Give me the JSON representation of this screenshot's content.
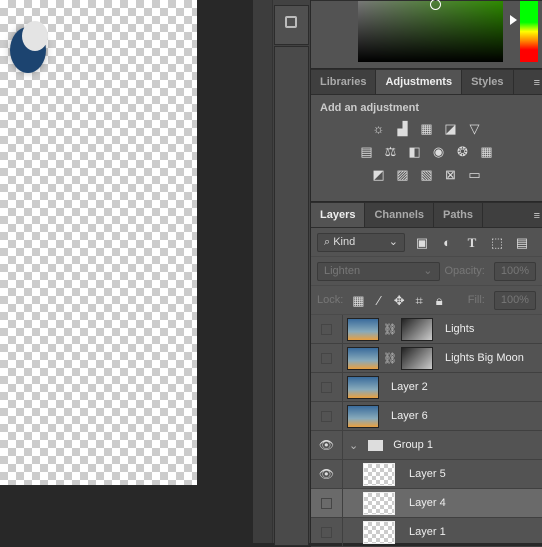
{
  "adjustments": {
    "tabs": [
      "Libraries",
      "Adjustments",
      "Styles"
    ],
    "active": "Adjustments",
    "heading": "Add an adjustment",
    "rows": [
      [
        "brightness-contrast",
        "levels",
        "curves",
        "exposure",
        "vibrance"
      ],
      [
        "hue-saturation",
        "color-balance",
        "black-white",
        "photo-filter",
        "channel-mixer",
        "color-lookup"
      ],
      [
        "invert",
        "posterize",
        "threshold",
        "gradient-map",
        "selective-color"
      ]
    ]
  },
  "layers": {
    "tabs": [
      "Layers",
      "Channels",
      "Paths"
    ],
    "active": "Layers",
    "filter": "Kind",
    "blend_mode": "Lighten",
    "opacity_label": "Opacity:",
    "opacity": "100%",
    "lock_label": "Lock:",
    "fill_label": "Fill:",
    "fill": "100%",
    "items": [
      {
        "name": "Lights",
        "visible": false,
        "type": "mask"
      },
      {
        "name": "Lights Big Moon",
        "visible": false,
        "type": "mask"
      },
      {
        "name": "Layer 2",
        "visible": false,
        "type": "image"
      },
      {
        "name": "Layer 6",
        "visible": false,
        "type": "image"
      },
      {
        "name": "Group 1",
        "visible": true,
        "type": "group"
      },
      {
        "name": "Layer 5",
        "visible": true,
        "type": "transparent"
      },
      {
        "name": "Layer 4",
        "visible": false,
        "type": "transparent",
        "selected": true
      },
      {
        "name": "Layer 1",
        "visible": false,
        "type": "transparent"
      }
    ]
  },
  "colors": {
    "panel": "#535353",
    "selected_layer": "#6a6a6a",
    "moon": "#1c4470"
  }
}
